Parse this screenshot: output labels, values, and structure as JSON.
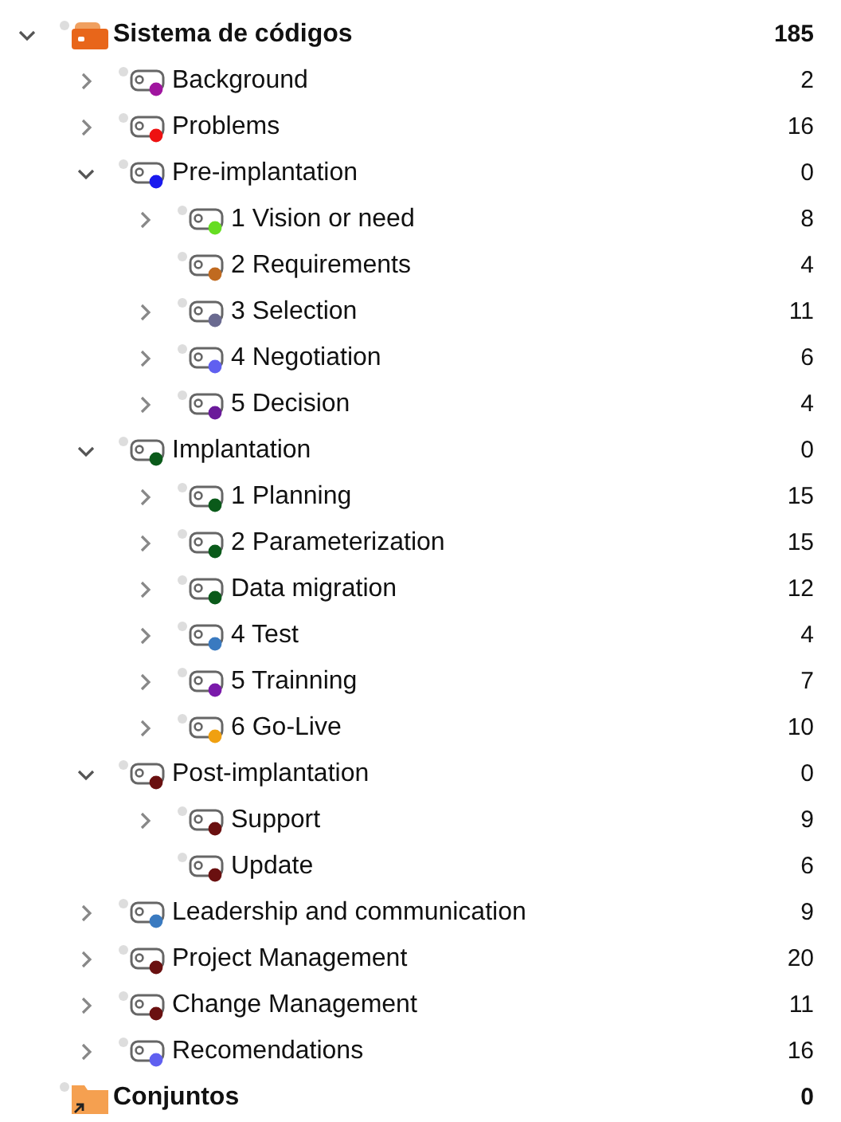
{
  "tree": [
    {
      "kind": "codesystem",
      "label": "Sistema de códigos",
      "count": "185",
      "expanded": true,
      "children": [
        {
          "kind": "code",
          "label": "Background",
          "count": "2",
          "color": "#a0159f",
          "expanded": false
        },
        {
          "kind": "code",
          "label": "Problems",
          "count": "16",
          "color": "#ee1111",
          "expanded": false
        },
        {
          "kind": "code",
          "label": "Pre-implantation",
          "count": "0",
          "color": "#1a1aee",
          "expanded": true,
          "children": [
            {
              "kind": "code",
              "label": "1 Vision or need",
              "count": "8",
              "color": "#66dd22",
              "expanded": false
            },
            {
              "kind": "code",
              "label": "2 Requirements",
              "count": "4",
              "color": "#c06a20"
            },
            {
              "kind": "code",
              "label": "3 Selection",
              "count": "11",
              "color": "#6a6a90",
              "expanded": false
            },
            {
              "kind": "code",
              "label": "4 Negotiation",
              "count": "6",
              "color": "#6060f0",
              "expanded": false
            },
            {
              "kind": "code",
              "label": "5 Decision",
              "count": "4",
              "color": "#6a1a9a",
              "expanded": false
            }
          ]
        },
        {
          "kind": "code",
          "label": "Implantation",
          "count": "0",
          "color": "#0a5a1a",
          "expanded": true,
          "children": [
            {
              "kind": "code",
              "label": "1 Planning",
              "count": "15",
              "color": "#0a5a1a",
              "expanded": false
            },
            {
              "kind": "code",
              "label": "2 Parameterization",
              "count": "15",
              "color": "#0a5a1a",
              "expanded": false
            },
            {
              "kind": "code",
              "label": "Data migration",
              "count": "12",
              "color": "#0a5a1a",
              "expanded": false
            },
            {
              "kind": "code",
              "label": "4 Test",
              "count": "4",
              "color": "#3a7ac0",
              "expanded": false
            },
            {
              "kind": "code",
              "label": "5 Trainning",
              "count": "7",
              "color": "#7a1aaa",
              "expanded": false
            },
            {
              "kind": "code",
              "label": "6 Go-Live",
              "count": "10",
              "color": "#f0a010",
              "expanded": false
            }
          ]
        },
        {
          "kind": "code",
          "label": "Post-implantation",
          "count": "0",
          "color": "#6a1010",
          "expanded": true,
          "children": [
            {
              "kind": "code",
              "label": "Support",
              "count": "9",
              "color": "#6a1010",
              "expanded": false
            },
            {
              "kind": "code",
              "label": "Update",
              "count": "6",
              "color": "#6a1010"
            }
          ]
        },
        {
          "kind": "code",
          "label": "Leadership and communication",
          "count": "9",
          "color": "#3a7ac0",
          "expanded": false
        },
        {
          "kind": "code",
          "label": "Project Management",
          "count": "20",
          "color": "#6a1010",
          "expanded": false
        },
        {
          "kind": "code",
          "label": "Change Management",
          "count": "11",
          "color": "#6a1010",
          "expanded": false
        },
        {
          "kind": "code",
          "label": "Recomendations",
          "count": "16",
          "color": "#6060f0",
          "expanded": false
        }
      ]
    },
    {
      "kind": "sets",
      "label": "Conjuntos",
      "count": "0"
    }
  ]
}
